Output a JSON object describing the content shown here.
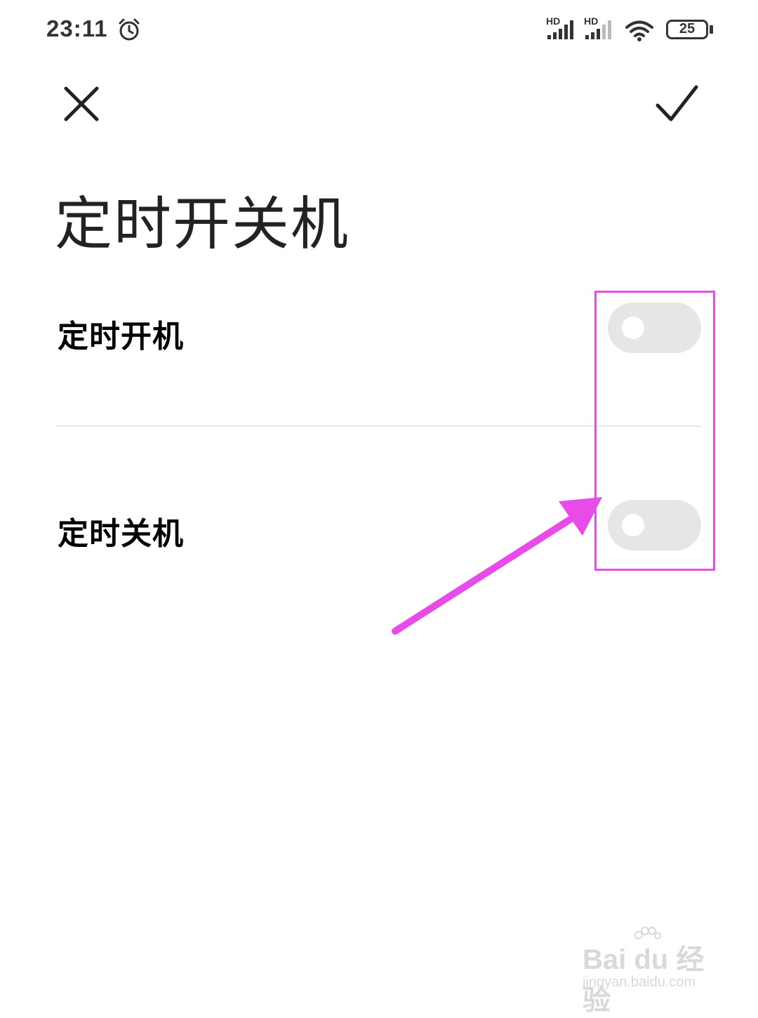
{
  "status_bar": {
    "time": "23:11",
    "sim1_label": "HD",
    "sim2_label": "HD",
    "battery": "25",
    "icons": [
      "alarm-icon",
      "signal-icon",
      "signal-icon",
      "wifi-icon",
      "battery-icon"
    ]
  },
  "header": {
    "close_icon": "close-icon",
    "confirm_icon": "checkmark-icon"
  },
  "page_title": "定时开关机",
  "settings": [
    {
      "label": "定时开机",
      "enabled": false
    },
    {
      "label": "定时关机",
      "enabled": false
    }
  ],
  "annotation": {
    "highlight_color": "#e84ce8",
    "arrow_color": "#e84ce8"
  },
  "watermark": {
    "main": "Bai du 经验",
    "sub": "jingyan.baidu.com"
  },
  "colors": {
    "toggle_off": "#e6e6e6",
    "title_text": "#222222"
  }
}
